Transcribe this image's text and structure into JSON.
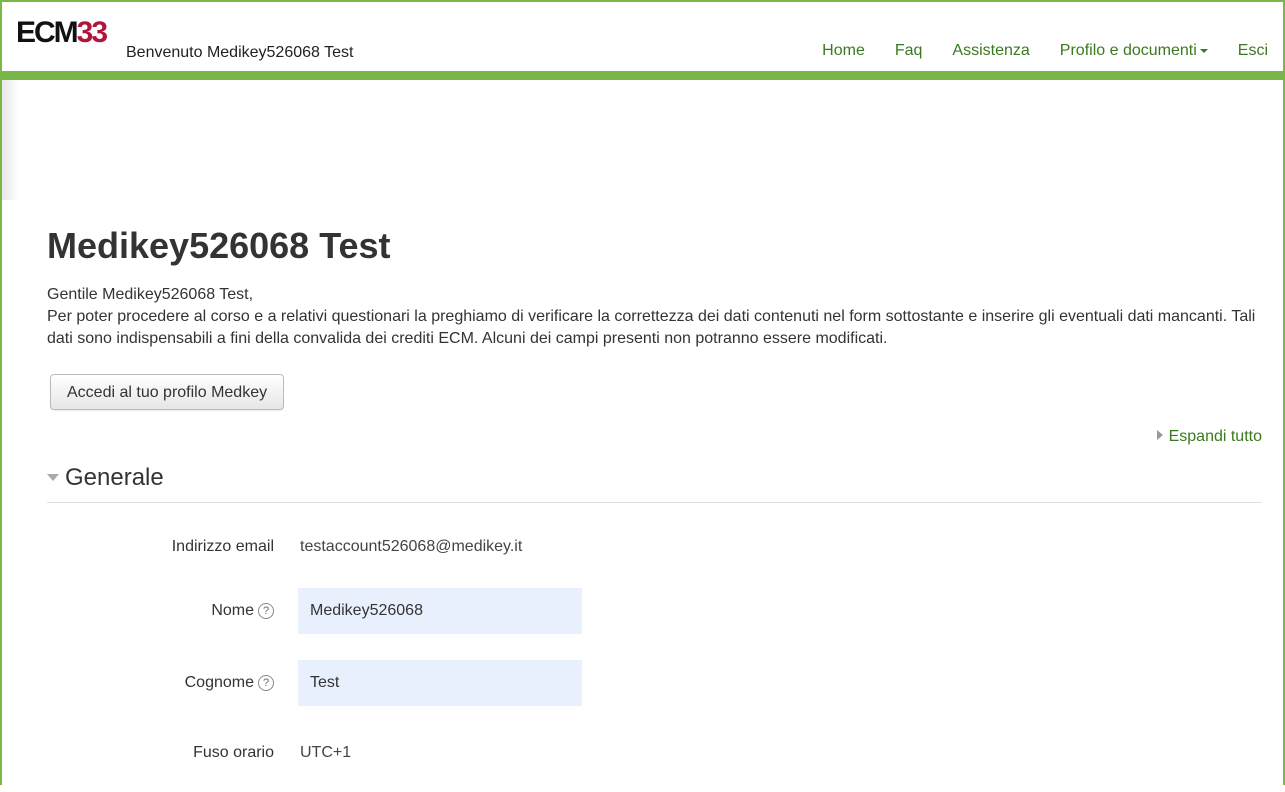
{
  "header": {
    "brand_part1": "ECM",
    "brand_part2": "33",
    "welcome": "Benvenuto Medikey526068 Test",
    "nav": [
      {
        "label": "Home"
      },
      {
        "label": "Faq"
      },
      {
        "label": "Assistenza"
      },
      {
        "label": "Profilo e documenti"
      },
      {
        "label": "Esci"
      }
    ]
  },
  "main": {
    "title": "Medikey526068 Test",
    "greeting": "Gentile Medikey526068 Test,",
    "intro": "Per poter procedere al corso e a relativi questionari la preghiamo di verificare la correttezza dei dati contenuti nel form sottostante e inserire gli eventuali dati mancanti. Tali dati sono indispensabili a fini della convalida dei crediti ECM. Alcuni dei campi presenti non potranno essere modificati.",
    "profile_button": "Accedi al tuo profilo Medkey",
    "expand_all": "Espandi tutto",
    "section_title": "Generale",
    "fields": {
      "email_label": "Indirizzo email",
      "email_value": "testaccount526068@medikey.it",
      "name_label": "Nome",
      "name_value": "Medikey526068",
      "surname_label": "Cognome",
      "surname_value": "Test",
      "timezone_label": "Fuso orario",
      "timezone_value": "UTC+1"
    }
  },
  "colors": {
    "accent": "#7ab648",
    "brand_red": "#b0163c",
    "link": "#3a7a1f",
    "input_bg": "#e8f0fe"
  }
}
